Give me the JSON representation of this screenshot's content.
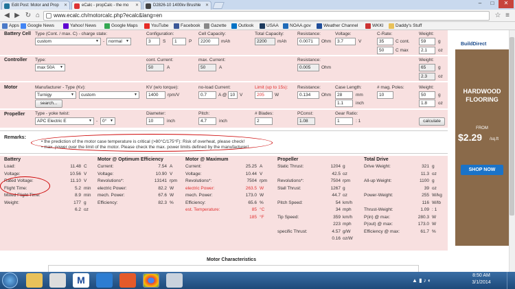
{
  "tabs": [
    {
      "title": "Edit Post: Motor and Prop",
      "active": false
    },
    {
      "title": "eCalc - propCalc - the mo",
      "active": true
    },
    {
      "title": "D2826-10 1400kv Brushle",
      "active": false
    }
  ],
  "address": {
    "url": "www.ecalc.ch/motorcalc.php?ecalc&lang=en"
  },
  "bookmarks": [
    "Apps",
    "Google News",
    "Yahoo! News",
    "Google Maps",
    "YouTube",
    "Facebook",
    "Gazette",
    "Outlook",
    "USAA",
    "NOAA.gov",
    "Weather Channel",
    "WKKI",
    "Daddy's Stuff"
  ],
  "battery_cell": {
    "section": "Battery Cell",
    "type_label": "Type (Cont. / max. C) - charge state:",
    "type_value": "custom",
    "charge_value": "normal",
    "config_label": "Configuration:",
    "config_s": "3",
    "s_label": "S",
    "config_p": "1",
    "p_label": "P",
    "cap_label": "Cell Capacity:",
    "cap_value": "2200",
    "cap_unit": "mAh",
    "total_label": "Total Capacity:",
    "total_value": "2200",
    "total_unit": "mAh",
    "res_label": "Resistance:",
    "res_value": "0.0071",
    "res_unit": "Ohm",
    "volt_label": "Voltage:",
    "volt_value": "3.7",
    "volt_unit": "V",
    "crate_label": "C-Rate:",
    "c_cont": "35",
    "c_cont_label": "C cont.",
    "c_max": "50",
    "c_max_label": "C max",
    "weight_label": "Weight:",
    "weight_g": "59",
    "weight_g_unit": "g",
    "weight_oz": "2.1",
    "weight_oz_unit": "oz"
  },
  "controller": {
    "section": "Controller",
    "type_label": "Type:",
    "type_value": "max 50A",
    "cont_label": "cont. Current:",
    "cont_value": "50",
    "cont_unit": "A",
    "max_label": "max. Current:",
    "max_value": "50",
    "max_unit": "A",
    "res_label": "Resistance:",
    "res_value": "0.005",
    "res_unit": "Ohm",
    "weight_label": "Weight:",
    "weight_g": "65",
    "weight_g_unit": "g",
    "weight_oz": "2.3",
    "weight_oz_unit": "oz"
  },
  "motor": {
    "section": "Motor",
    "mfr_label": "Manufacturer - Type (Kv):",
    "mfr_value": "Turnigy",
    "type_value": "custom",
    "search_label": "search...",
    "kv_label": "KV (w/o torque):",
    "kv_value": "1400",
    "kv_unit": "rpm/V",
    "noload_label": "no-load Current:",
    "noload_value": "0.7",
    "noload_unit": "A @",
    "noload_v": "10",
    "noload_v_unit": "V",
    "limit_label": "Limit (up to 15s):",
    "limit_value": "205",
    "limit_unit": "W",
    "res_label": "Resistance:",
    "res_value": "0.134",
    "res_unit": "Ohm",
    "case_label": "Case Length:",
    "case_mm": "28",
    "case_mm_unit": "mm",
    "case_in": "1.1",
    "case_in_unit": "inch",
    "poles_label": "# mag. Poles:",
    "poles_value": "10",
    "weight_label": "Weight:",
    "weight_g": "50",
    "weight_g_unit": "g",
    "weight_oz": "1.8",
    "weight_oz_unit": "oz"
  },
  "propeller": {
    "section": "Propeller",
    "type_label": "Type - yoke twist:",
    "type_value": "APC Electric E",
    "twist_value": "0°",
    "dia_label": "Diameter:",
    "dia_value": "10",
    "dia_unit": "inch",
    "pitch_label": "Pitch:",
    "pitch_value": "4.7",
    "pitch_unit": "inch",
    "blades_label": "# Blades:",
    "blades_value": "2",
    "pconst_label": "PConst:",
    "pconst_value": "1.08",
    "gear_label": "Gear Ratio:",
    "gear_value": "1",
    "gear_unit": ": 1",
    "calc_label": "calculate"
  },
  "remarks": {
    "label": "Remarks:",
    "items": [
      "the prediction of the motor case temperature is critical (>80°C/175°F): Risk of overheat, please check!",
      "max. power over the limit of the motor. Please check the max. power limits defined by the manufacturer!"
    ]
  },
  "results": {
    "battery": {
      "title": "Battery",
      "rows": [
        [
          "Load:",
          "11.48",
          "C"
        ],
        [
          "Voltage:",
          "10.56",
          "V"
        ],
        [
          "Rated Voltage:",
          "11.10",
          "V"
        ],
        [
          "Flight Time:",
          "5.2",
          "min"
        ],
        [
          "Mixed Flight Time:",
          "8.9",
          "min"
        ],
        [
          "Weight:",
          "177",
          "g"
        ],
        [
          "",
          "6.2",
          "oz"
        ]
      ]
    },
    "motor_opt": {
      "title": "Motor @ Optimum Efficiency",
      "rows": [
        [
          "Current:",
          "7.54",
          "A"
        ],
        [
          "Voltage:",
          "10.90",
          "V"
        ],
        [
          "Revolutions*:",
          "13141",
          "rpm"
        ],
        [
          "electric Power:",
          "82.2",
          "W"
        ],
        [
          "mech. Power:",
          "67.6",
          "W"
        ],
        [
          "Efficiency:",
          "82.3",
          "%"
        ]
      ]
    },
    "motor_max": {
      "title": "Motor @ Maximum",
      "rows": [
        [
          "Current:",
          "25.25",
          "A",
          false
        ],
        [
          "Voltage:",
          "10.44",
          "V",
          false
        ],
        [
          "Revolutions*:",
          "7504",
          "rpm",
          false
        ],
        [
          "electric Power:",
          "263.5",
          "W",
          true
        ],
        [
          "mech. Power:",
          "173.0",
          "W",
          false
        ],
        [
          "Efficiency:",
          "65.6",
          "%",
          false
        ],
        [
          "est. Temperature:",
          "85",
          "°C",
          true
        ],
        [
          "",
          "185",
          "°F",
          true
        ]
      ]
    },
    "propeller": {
      "title": "Propeller",
      "rows": [
        [
          "Static Thrust:",
          "1204",
          "g"
        ],
        [
          "",
          "42.5",
          "oz"
        ],
        [
          "Revolutions*:",
          "7504",
          "rpm"
        ],
        [
          "Stall Thrust:",
          "1267",
          "g"
        ],
        [
          "",
          "44.7",
          "oz"
        ],
        [
          "Pitch Speed:",
          "54",
          "km/h"
        ],
        [
          "",
          "34",
          "mph"
        ],
        [
          "Tip Speed:",
          "359",
          "km/h"
        ],
        [
          "",
          "223",
          "mph"
        ],
        [
          "specific Thrust:",
          "4.57",
          "g/W"
        ],
        [
          "",
          "0.16",
          "oz/W"
        ]
      ]
    },
    "total_drive": {
      "title": "Total Drive",
      "rows": [
        [
          "Drive Weight:",
          "321",
          "g"
        ],
        [
          "",
          "11.3",
          "oz"
        ],
        [
          "All-up Weight:",
          "1100",
          "g"
        ],
        [
          "",
          "39",
          "oz"
        ],
        [
          "Power-Weight:",
          "255",
          "W/kg"
        ],
        [
          "",
          "116",
          "W/lb"
        ],
        [
          "Thrust-Weight:",
          "1.09",
          ": 1"
        ],
        [
          "P(in) @ max:",
          "280.3",
          "W"
        ],
        [
          "P(out) @ max:",
          "173.0",
          "W"
        ],
        [
          "Efficiency @ max:",
          "61.7",
          "%"
        ]
      ]
    }
  },
  "motor_characteristics": {
    "title": "Motor Characteristics"
  },
  "ad": {
    "brand": "BuildDirect",
    "line1": "HARDWOOD",
    "line2": "FLOORING",
    "from": "FROM",
    "price": "$2.29",
    "per": "/sq.ft",
    "cta": "SHOP NOW"
  },
  "clock": {
    "time": "8:50 AM",
    "date": "3/1/2014"
  },
  "colors": {
    "accent_red": "#e03030",
    "section_pink": "#f8e0e0",
    "ad_cta": "#1a73c8"
  }
}
